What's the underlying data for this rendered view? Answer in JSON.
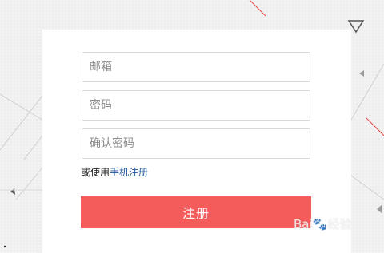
{
  "form": {
    "email_placeholder": "邮箱",
    "password_placeholder": "密码",
    "confirm_placeholder": "确认密码",
    "alt_prefix": "或使用",
    "alt_link": "手机注册",
    "submit_label": "注册"
  },
  "watermark": {
    "text": "Bai🐾经验"
  },
  "colors": {
    "accent": "#f45c5c",
    "link": "#1d4f9a",
    "border": "#dcdcdc"
  }
}
